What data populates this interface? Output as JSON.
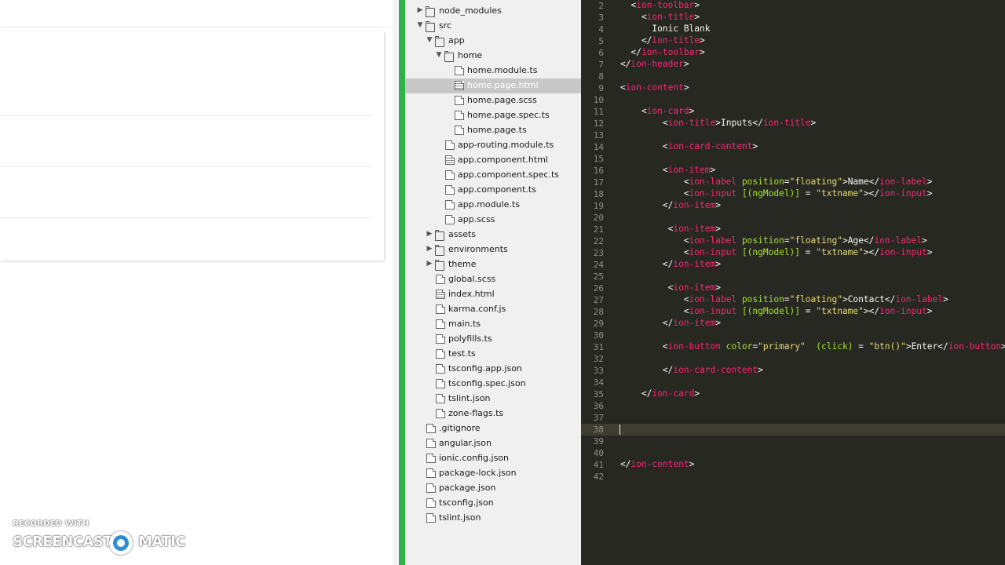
{
  "tree": {
    "items": [
      {
        "label": "node_modules",
        "kind": "folder",
        "collapsed": true,
        "depth": 1
      },
      {
        "label": "src",
        "kind": "folder-open",
        "collapsed": false,
        "depth": 1
      },
      {
        "label": "app",
        "kind": "folder-open",
        "collapsed": false,
        "depth": 2
      },
      {
        "label": "home",
        "kind": "folder-open",
        "collapsed": false,
        "depth": 3
      },
      {
        "label": "home.module.ts",
        "kind": "file",
        "depth": 4
      },
      {
        "label": "home.page.html",
        "kind": "file-code",
        "depth": 4,
        "selected": true
      },
      {
        "label": "home.page.scss",
        "kind": "file",
        "depth": 4
      },
      {
        "label": "home.page.spec.ts",
        "kind": "file",
        "depth": 4
      },
      {
        "label": "home.page.ts",
        "kind": "file",
        "depth": 4
      },
      {
        "label": "app-routing.module.ts",
        "kind": "file",
        "depth": 3
      },
      {
        "label": "app.component.html",
        "kind": "file-code",
        "depth": 3
      },
      {
        "label": "app.component.spec.ts",
        "kind": "file",
        "depth": 3
      },
      {
        "label": "app.component.ts",
        "kind": "file",
        "depth": 3
      },
      {
        "label": "app.module.ts",
        "kind": "file",
        "depth": 3
      },
      {
        "label": "app.scss",
        "kind": "file",
        "depth": 3
      },
      {
        "label": "assets",
        "kind": "folder",
        "collapsed": true,
        "depth": 2
      },
      {
        "label": "environments",
        "kind": "folder",
        "collapsed": true,
        "depth": 2
      },
      {
        "label": "theme",
        "kind": "folder",
        "collapsed": true,
        "depth": 2
      },
      {
        "label": "global.scss",
        "kind": "file",
        "depth": 2
      },
      {
        "label": "index.html",
        "kind": "file-code",
        "depth": 2
      },
      {
        "label": "karma.conf.js",
        "kind": "file",
        "depth": 2
      },
      {
        "label": "main.ts",
        "kind": "file",
        "depth": 2
      },
      {
        "label": "polyfills.ts",
        "kind": "file",
        "depth": 2
      },
      {
        "label": "test.ts",
        "kind": "file",
        "depth": 2
      },
      {
        "label": "tsconfig.app.json",
        "kind": "file",
        "depth": 2
      },
      {
        "label": "tsconfig.spec.json",
        "kind": "file",
        "depth": 2
      },
      {
        "label": "tslint.json",
        "kind": "file",
        "depth": 2
      },
      {
        "label": "zone-flags.ts",
        "kind": "file",
        "depth": 2
      },
      {
        "label": ".gitignore",
        "kind": "file",
        "depth": 1
      },
      {
        "label": "angular.json",
        "kind": "file",
        "depth": 1
      },
      {
        "label": "ionic.config.json",
        "kind": "file",
        "depth": 1
      },
      {
        "label": "package-lock.json",
        "kind": "file",
        "depth": 1
      },
      {
        "label": "package.json",
        "kind": "file",
        "depth": 1
      },
      {
        "label": "tsconfig.json",
        "kind": "file",
        "depth": 1
      },
      {
        "label": "tslint.json",
        "kind": "file",
        "depth": 1
      }
    ]
  },
  "editor": {
    "current_line": 38,
    "lines": [
      {
        "n": "2",
        "tokens": [
          [
            "p",
            "  <"
          ],
          [
            "t",
            "ion-toolbar"
          ],
          [
            "p",
            ">"
          ]
        ]
      },
      {
        "n": "3",
        "tokens": [
          [
            "p",
            "    <"
          ],
          [
            "t",
            "ion-title"
          ],
          [
            "p",
            ">"
          ]
        ]
      },
      {
        "n": "4",
        "tokens": [
          [
            "x",
            "      Ionic Blank"
          ]
        ]
      },
      {
        "n": "5",
        "tokens": [
          [
            "p",
            "    </"
          ],
          [
            "t",
            "ion-title"
          ],
          [
            "p",
            ">"
          ]
        ]
      },
      {
        "n": "6",
        "tokens": [
          [
            "p",
            "  </"
          ],
          [
            "t",
            "ion-toolbar"
          ],
          [
            "p",
            ">"
          ]
        ]
      },
      {
        "n": "7",
        "tokens": [
          [
            "p",
            "</"
          ],
          [
            "t",
            "ion-header"
          ],
          [
            "p",
            ">"
          ]
        ]
      },
      {
        "n": "8",
        "tokens": []
      },
      {
        "n": "9",
        "tokens": [
          [
            "p",
            "<"
          ],
          [
            "t",
            "ion-content"
          ],
          [
            "p",
            ">"
          ]
        ]
      },
      {
        "n": "10",
        "tokens": []
      },
      {
        "n": "11",
        "tokens": [
          [
            "p",
            "    <"
          ],
          [
            "t",
            "ion-card"
          ],
          [
            "p",
            ">"
          ]
        ]
      },
      {
        "n": "12",
        "tokens": [
          [
            "p",
            "        <"
          ],
          [
            "t",
            "ion-title"
          ],
          [
            "p",
            ">"
          ],
          [
            "x",
            "Inputs"
          ],
          [
            "p",
            "</"
          ],
          [
            "t",
            "ion-title"
          ],
          [
            "p",
            ">"
          ]
        ]
      },
      {
        "n": "13",
        "tokens": []
      },
      {
        "n": "14",
        "tokens": [
          [
            "p",
            "        <"
          ],
          [
            "t",
            "ion-card-content"
          ],
          [
            "p",
            ">"
          ]
        ]
      },
      {
        "n": "15",
        "tokens": []
      },
      {
        "n": "16",
        "tokens": [
          [
            "p",
            "        <"
          ],
          [
            "t",
            "ion-item"
          ],
          [
            "p",
            ">"
          ]
        ]
      },
      {
        "n": "17",
        "tokens": [
          [
            "p",
            "            <"
          ],
          [
            "t",
            "ion-label"
          ],
          [
            "x",
            " "
          ],
          [
            "a",
            "position"
          ],
          [
            "p",
            "="
          ],
          [
            "s",
            "\"floating\""
          ],
          [
            "p",
            ">"
          ],
          [
            "x",
            "Name"
          ],
          [
            "p",
            "</"
          ],
          [
            "t",
            "ion-label"
          ],
          [
            "p",
            ">"
          ]
        ]
      },
      {
        "n": "18",
        "tokens": [
          [
            "p",
            "            <"
          ],
          [
            "t",
            "ion-input"
          ],
          [
            "x",
            " "
          ],
          [
            "a",
            "[(ngModel)]"
          ],
          [
            "x",
            " = "
          ],
          [
            "s",
            "\"txtname\""
          ],
          [
            "p",
            "></"
          ],
          [
            "t",
            "ion-input"
          ],
          [
            "p",
            ">"
          ]
        ]
      },
      {
        "n": "19",
        "tokens": [
          [
            "p",
            "        </"
          ],
          [
            "t",
            "ion-item"
          ],
          [
            "p",
            ">"
          ]
        ]
      },
      {
        "n": "20",
        "tokens": []
      },
      {
        "n": "21",
        "tokens": [
          [
            "p",
            "         <"
          ],
          [
            "t",
            "ion-item"
          ],
          [
            "p",
            ">"
          ]
        ]
      },
      {
        "n": "22",
        "tokens": [
          [
            "p",
            "            <"
          ],
          [
            "t",
            "ion-label"
          ],
          [
            "x",
            " "
          ],
          [
            "a",
            "position"
          ],
          [
            "p",
            "="
          ],
          [
            "s",
            "\"floating\""
          ],
          [
            "p",
            ">"
          ],
          [
            "x",
            "Age"
          ],
          [
            "p",
            "</"
          ],
          [
            "t",
            "ion-label"
          ],
          [
            "p",
            ">"
          ]
        ]
      },
      {
        "n": "23",
        "tokens": [
          [
            "p",
            "            <"
          ],
          [
            "t",
            "ion-input"
          ],
          [
            "x",
            " "
          ],
          [
            "a",
            "[(ngModel)]"
          ],
          [
            "x",
            " = "
          ],
          [
            "s",
            "\"txtname\""
          ],
          [
            "p",
            "></"
          ],
          [
            "t",
            "ion-input"
          ],
          [
            "p",
            ">"
          ]
        ]
      },
      {
        "n": "24",
        "tokens": [
          [
            "p",
            "        </"
          ],
          [
            "t",
            "ion-item"
          ],
          [
            "p",
            ">"
          ]
        ]
      },
      {
        "n": "25",
        "tokens": []
      },
      {
        "n": "26",
        "tokens": [
          [
            "p",
            "         <"
          ],
          [
            "t",
            "ion-item"
          ],
          [
            "p",
            ">"
          ]
        ]
      },
      {
        "n": "27",
        "tokens": [
          [
            "p",
            "            <"
          ],
          [
            "t",
            "ion-label"
          ],
          [
            "x",
            " "
          ],
          [
            "a",
            "position"
          ],
          [
            "p",
            "="
          ],
          [
            "s",
            "\"floating\""
          ],
          [
            "p",
            ">"
          ],
          [
            "x",
            "Contact"
          ],
          [
            "p",
            "</"
          ],
          [
            "t",
            "ion-label"
          ],
          [
            "p",
            ">"
          ]
        ]
      },
      {
        "n": "28",
        "tokens": [
          [
            "p",
            "            <"
          ],
          [
            "t",
            "ion-input"
          ],
          [
            "x",
            " "
          ],
          [
            "a",
            "[(ngModel)]"
          ],
          [
            "x",
            " = "
          ],
          [
            "s",
            "\"txtname\""
          ],
          [
            "p",
            "></"
          ],
          [
            "t",
            "ion-input"
          ],
          [
            "p",
            ">"
          ]
        ]
      },
      {
        "n": "29",
        "tokens": [
          [
            "p",
            "        </"
          ],
          [
            "t",
            "ion-item"
          ],
          [
            "p",
            ">"
          ]
        ]
      },
      {
        "n": "30",
        "tokens": []
      },
      {
        "n": "31",
        "tokens": [
          [
            "p",
            "        <"
          ],
          [
            "t",
            "ion-button"
          ],
          [
            "x",
            " "
          ],
          [
            "a",
            "color"
          ],
          [
            "p",
            "="
          ],
          [
            "s",
            "\"primary\""
          ],
          [
            "x",
            "  "
          ],
          [
            "a",
            "(click)"
          ],
          [
            "x",
            " = "
          ],
          [
            "s",
            "\"btn()\""
          ],
          [
            "p",
            ">"
          ],
          [
            "x",
            "Enter"
          ],
          [
            "p",
            "</"
          ],
          [
            "t",
            "ion-button"
          ],
          [
            "p",
            ">"
          ]
        ]
      },
      {
        "n": "32",
        "tokens": []
      },
      {
        "n": "33",
        "tokens": [
          [
            "p",
            "        </"
          ],
          [
            "t",
            "ion-card-content"
          ],
          [
            "p",
            ">"
          ]
        ]
      },
      {
        "n": "34",
        "tokens": []
      },
      {
        "n": "35",
        "tokens": [
          [
            "p",
            "    </"
          ],
          [
            "t",
            "ion-card"
          ],
          [
            "p",
            ">"
          ]
        ]
      },
      {
        "n": "36",
        "tokens": []
      },
      {
        "n": "37",
        "tokens": []
      },
      {
        "n": "38",
        "tokens": []
      },
      {
        "n": "39",
        "tokens": []
      },
      {
        "n": "40",
        "tokens": []
      },
      {
        "n": "41",
        "tokens": [
          [
            "p",
            "</"
          ],
          [
            "t",
            "ion-content"
          ],
          [
            "p",
            ">"
          ]
        ]
      },
      {
        "n": "42",
        "tokens": []
      }
    ]
  },
  "watermark": {
    "recorded_with": "RECORDED WITH",
    "brand_left": "SCREENCAST",
    "brand_right": "MATIC"
  },
  "colors": {
    "editor_bg": "#272822",
    "tag": "#f92672",
    "attr": "#a6e22e",
    "string": "#e6db74",
    "accent_bar": "#2cb34a",
    "selection": "#c8c8c8"
  }
}
